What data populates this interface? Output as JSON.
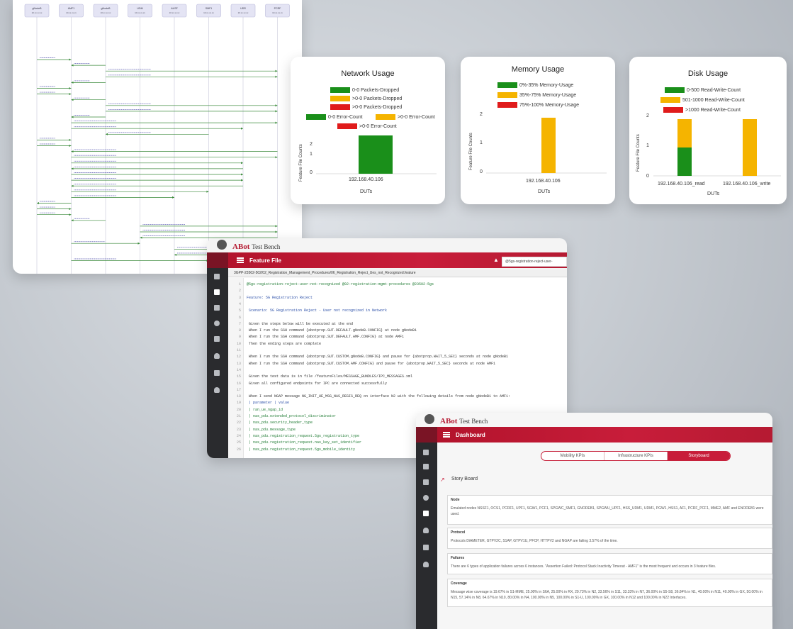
{
  "sequence": {
    "actors": [
      "gNodeB",
      "AMF1",
      "gNodeB",
      "UDM",
      "AUSF",
      "SMF1",
      "UDR",
      "PCRF"
    ],
    "actor_subs": [
      "10.xx.xx.xx",
      "10.xx.xx.xx",
      "10.xx.xx.xx",
      "10.xx.xx.xx",
      "10.xx.xx.xx",
      "10.xx.xx.xx",
      "10.xx.xx.xx",
      "10.xx.xx.xx"
    ]
  },
  "network_card": {
    "title": "Network Usage",
    "legend": [
      "0-0 Packets-Dropped",
      ">0-0 Packets-Dropped",
      ">0-0 Packets-Dropped",
      "0-0 Error-Count",
      ">0-0 Error-Count",
      ">0-0 Error-Count"
    ],
    "ylabel": "Feature File Counts",
    "yticks": [
      "2",
      "1",
      "0"
    ],
    "xticks": [
      "192.168.40.106"
    ],
    "xlabel": "DUTs"
  },
  "memory_card": {
    "title": "Memory Usage",
    "legend": [
      "0%-35% Memory-Usage",
      "35%-75% Memory-Usage",
      "75%-100% Memory-Usage"
    ],
    "ylabel": "Feature File Counts",
    "yticks": [
      "2",
      "1",
      "0"
    ],
    "xticks": [
      "192.168.40.106"
    ],
    "xlabel": "DUTs"
  },
  "disk_card": {
    "title": "Disk Usage",
    "legend": [
      "0-500 Read-Write-Count",
      "501-1000 Read-Write-Count",
      ">1000 Read-Write-Count"
    ],
    "ylabel": "Feature File Counts",
    "yticks": [
      "2",
      "1",
      "0"
    ],
    "xticks": [
      "192.168.40.106_read",
      "192.168.40.106_write"
    ],
    "xlabel": "DUTs"
  },
  "chart_data": [
    {
      "type": "bar",
      "title": "Network Usage",
      "categories": [
        "192.168.40.106"
      ],
      "series": [
        {
          "name": "0-0 Packets-Dropped",
          "values": [
            2
          ]
        }
      ],
      "xlabel": "DUTs",
      "ylabel": "Feature File Counts",
      "ylim": [
        0,
        2
      ]
    },
    {
      "type": "bar",
      "title": "Memory Usage",
      "categories": [
        "192.168.40.106"
      ],
      "series": [
        {
          "name": "35%-75% Memory-Usage",
          "values": [
            2
          ]
        }
      ],
      "xlabel": "DUTs",
      "ylabel": "Feature File Counts",
      "ylim": [
        0,
        2
      ]
    },
    {
      "type": "bar",
      "title": "Disk Usage",
      "categories": [
        "192.168.40.106_read",
        "192.168.40.106_write"
      ],
      "series": [
        {
          "name": "0-500 Read-Write-Count",
          "values": [
            1,
            0
          ]
        },
        {
          "name": "501-1000 Read-Write-Count",
          "values": [
            1,
            2
          ]
        }
      ],
      "xlabel": "DUTs",
      "ylabel": "Feature File Counts",
      "ylim": [
        0,
        2
      ]
    }
  ],
  "colors": {
    "green": "#1a8f1a",
    "amber": "#f5b400",
    "red": "#e01b1b",
    "brand": "#c81d3a"
  },
  "feature_app": {
    "logo": "ABot",
    "logo_sub": "Test Bench",
    "bar_title": "Feature File",
    "search_value": "@5gs-registration-reject-user-",
    "path": "3GPP-23502-502/02_Registration_Management_Procedures/06_Registration_Reject_Ues_not_Recognized.feature",
    "lines": [
      {
        "n": "1",
        "t": "@5gs-registration-reject-user-not-recognized @02-registration-mgmt-procedures @23502-5gs",
        "c": "tag"
      },
      {
        "n": "2",
        "t": "",
        "c": ""
      },
      {
        "n": "3",
        "t": "Feature: 5G Registration Reject",
        "c": "kw"
      },
      {
        "n": "4",
        "t": "",
        "c": ""
      },
      {
        "n": "5",
        "t": "  Scenario: 5G Registration Reject - User not recognized in Network",
        "c": "kw"
      },
      {
        "n": "6",
        "t": "",
        "c": ""
      },
      {
        "n": "7",
        "t": "    Given the steps below will be executed at the end",
        "c": ""
      },
      {
        "n": "8",
        "t": "    When I run the SSH command {abotprop.SUT.DEFAULT.gNodeB.CONFIG} at node gNodeB1",
        "c": ""
      },
      {
        "n": "9",
        "t": "    When I run the SSH command {abotprop.SUT.DEFAULT.AMF.CONFIG} at node AMF1",
        "c": ""
      },
      {
        "n": "10",
        "t": "    Then the ending steps are complete",
        "c": ""
      },
      {
        "n": "11",
        "t": "",
        "c": ""
      },
      {
        "n": "12",
        "t": "    When I run the SSH command {abotprop.SUT.CUSTOM.gNodeB.CONFIG} and pause for {abotprop.WAIT_5_SEC} seconds at node gNodeB1",
        "c": ""
      },
      {
        "n": "13",
        "t": "    When I run the SSH command {abotprop.SUT.CUSTOM.AMF.CONFIG} and pause for {abotprop.WAIT_5_SEC} seconds at node AMF1",
        "c": ""
      },
      {
        "n": "14",
        "t": "",
        "c": ""
      },
      {
        "n": "15",
        "t": "    Given the test data is in file /featureFiles/MESSAGE_BUNDLES/IPC_MESSAGES.xml",
        "c": ""
      },
      {
        "n": "16",
        "t": "    Given all configured endpoints for IPC are connected successfully",
        "c": ""
      },
      {
        "n": "17",
        "t": "",
        "c": ""
      },
      {
        "n": "18",
        "t": "    When I send NGAP message NG_INIT_UE_MSG_NAS_REGIS_REQ on interface N2 with the following details from node gNodeB1 to AMF1:",
        "c": ""
      },
      {
        "n": "19",
        "t": "      | parameter                                         | value",
        "c": "kw"
      },
      {
        "n": "20",
        "t": "      | ran_ue_ngap_id",
        "c": "str"
      },
      {
        "n": "21",
        "t": "      | nas_pdu.extended_protocol_discriminator",
        "c": "str"
      },
      {
        "n": "22",
        "t": "      | nas_pdu.security_header_type",
        "c": "str"
      },
      {
        "n": "23",
        "t": "      | nas_pdu.message_type",
        "c": "str"
      },
      {
        "n": "24",
        "t": "      | nas_pdu.registration_request.5gs_registration_type",
        "c": "str"
      },
      {
        "n": "25",
        "t": "      | nas_pdu.registration_request.nas_key_set_identifier",
        "c": "str"
      },
      {
        "n": "26",
        "t": "      | nas_pdu.registration_request.5gs_mobile_identity",
        "c": "str"
      }
    ]
  },
  "dashboard_app": {
    "logo": "ABot",
    "logo_sub": "Test Bench",
    "bar_title": "Dashboard",
    "tabs": [
      "Mobility KPIs",
      "Infrastructure KPIs",
      "Storyboard"
    ],
    "story_title": "Story Board",
    "sections": [
      {
        "h": "Node",
        "b": "Emulated nodes NSSF1, OCS1, PCRF1, UPF1, SGW1, PCF1, SPGWC_SMF1, GNODEB1, SPGWU_UPF1, HSS_UDM1, UDM1, PGW1, HSS1, AF1, PCRF_PCF1, MME2, AMF and ENODEB1 were used."
      },
      {
        "h": "Protocol",
        "b": "Protocols DiAMETER, GTPV2C, S1AP, GTPV1U, PFCP, HTTPV2 and NGAP are failing 3.57% of the time."
      },
      {
        "h": "Failures",
        "b": "There are 6 types of application failures across 6 instances. \"Assertion Failed: Protocol Stack Inactivity Timeout - AMF1\" is the most frequent and occurs in 3 feature files."
      },
      {
        "h": "Coverage",
        "b": "Message wise coverage is 19.67% in S1-MME, 25.00% in S6A, 25.00% in RX, 29.73% in N2, 33.56% in S11, 33.33% in N7, 36.00% in S5-S8, 36.84% in N1, 40.00% in N11, 40.00% in GX, 50.00% in N15, 57.14% in N8, 64.67% in N10, 80.00% in N4, 100.00% in N5, 100.00% in S1-U, 100.00% in GX, 100.00% in N12 and 100.00% in N22 Interfaces."
      }
    ]
  }
}
